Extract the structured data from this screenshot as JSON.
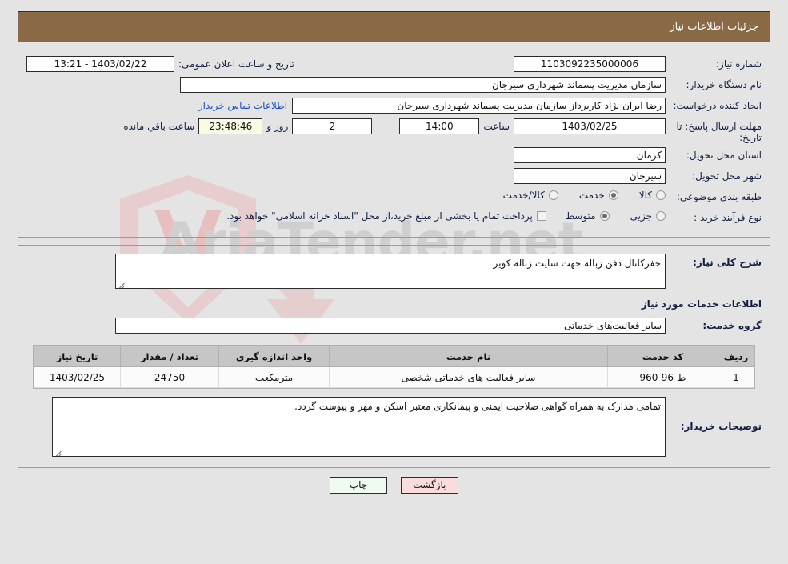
{
  "header": {
    "title": "جزئیات اطلاعات نیاز"
  },
  "need_info": {
    "need_number_label": "شماره نیاز:",
    "need_number_value": "1103092235000006",
    "public_announce_label": "تاریخ و ساعت اعلان عمومی:",
    "public_announce_value": "1403/02/22 - 13:21",
    "buyer_org_label": "نام دستگاه خریدار:",
    "buyer_org_value": "سازمان مدیریت پسماند شهرداری سیرجان",
    "creator_label": "ایجاد کننده درخواست:",
    "creator_value": "رضا ایران نژاد کاربرداز سازمان مدیریت پسماند شهرداری سیرجان",
    "contact_link": "اطلاعات تماس خریدار",
    "deadline_label": "مهلت ارسال پاسخ: تا تاریخ:",
    "deadline_date": "1403/02/25",
    "time_label": "ساعت",
    "time_value": "14:00",
    "days_value": "2",
    "days_and_label": "روز و",
    "countdown_value": "23:48:46",
    "remaining_label": "ساعت باقي مانده",
    "province_label": "استان محل تحویل:",
    "province_value": "کرمان",
    "city_label": "شهر محل تحویل:",
    "city_value": "سیرجان",
    "category_label": "طبقه بندی موضوعی:",
    "category_options": [
      {
        "label": "کالا",
        "checked": false
      },
      {
        "label": "خدمت",
        "checked": true
      },
      {
        "label": "کالا/خدمت",
        "checked": false
      }
    ],
    "process_label": "نوع فرآیند خرید :",
    "process_options": [
      {
        "label": "جزیی",
        "checked": false
      },
      {
        "label": "متوسط",
        "checked": true
      }
    ],
    "treasury_checkbox_label": "پرداخت تمام یا بخشی از مبلغ خرید،از محل \"اسناد خزانه اسلامی\" خواهد بود.",
    "treasury_checked": false
  },
  "details": {
    "general_desc_label": "شرح کلی نیاز:",
    "general_desc_value": "حفرکانال دفن زباله جهت سایت زباله کویر",
    "services_section_title": "اطلاعات خدمات مورد نیاز",
    "service_group_label": "گروه خدمت:",
    "service_group_value": "سایر فعالیت‌های خدماتی",
    "table": {
      "columns": [
        "ردیف",
        "کد خدمت",
        "نام خدمت",
        "واحد اندازه گیری",
        "تعداد / مقدار",
        "تاریخ نیاز"
      ],
      "rows": [
        {
          "row_no": "1",
          "service_code": "ط-96-960",
          "service_name": "سایر فعالیت های خدماتی شخصی",
          "unit": "مترمکعب",
          "quantity": "24750",
          "need_date": "1403/02/25"
        }
      ]
    },
    "buyer_notes_label": "توضیحات خریدار:",
    "buyer_notes_value": "تمامی مدارک به همراه گواهی صلاحیت ایمنی و پیمانکاری معتبر اسکن و مهر و پیوست گردد."
  },
  "footer": {
    "print_label": "چاپ",
    "back_label": "بازگشت"
  },
  "watermark": {
    "text": "AriaTender.net"
  },
  "colors": {
    "header_bg": "#8a6a44",
    "page_bg": "#e4e4e4",
    "label": "#132042",
    "link": "#1a4fd0",
    "table_header_bg": "#c6c6c6",
    "print_btn_bg": "#eefbee",
    "back_btn_bg": "#fbdcdc",
    "countdown_bg": "#fbfbe4"
  }
}
